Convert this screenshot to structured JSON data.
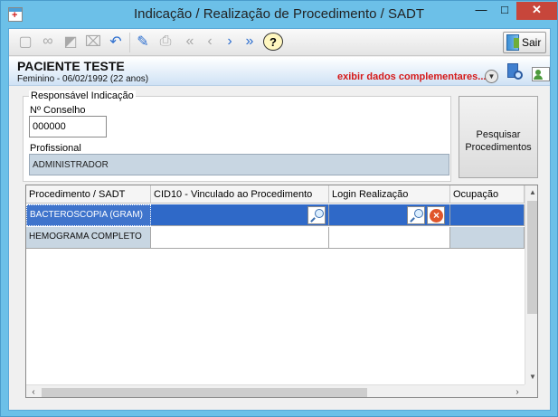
{
  "window": {
    "title": "Indicação / Realização de Procedimento / SADT",
    "min_glyph": "—",
    "max_glyph": "□",
    "close_glyph": "✕"
  },
  "toolbar": {
    "icons": [
      "new-icon",
      "binoculars-icon",
      "eraser-icon",
      "trash-icon",
      "undo-icon",
      "edit-icon",
      "print-icon",
      "first-icon",
      "prev-icon",
      "next-icon",
      "last-icon",
      "help-icon"
    ],
    "help_glyph": "?",
    "exit_label": "Sair"
  },
  "patient": {
    "name": "PACIENTE TESTE",
    "info": "Feminino - 06/02/1992 (22 anos)",
    "complement_link": "exibir dados complementares...",
    "expand_glyph": "▼"
  },
  "responsible": {
    "legend": "Responsável Indicação",
    "council_label": "Nº Conselho",
    "council_value": "000000",
    "professional_label": "Profissional",
    "professional_value": "ADMINISTRADOR"
  },
  "search_button": {
    "label": "Pesquisar Procedimentos"
  },
  "grid": {
    "columns": [
      "Procedimento / SADT",
      "CID10 - Vinculado ao Procedimento",
      "Login Realização",
      "Ocupação"
    ],
    "rows": [
      {
        "procedure": "BACTEROSCOPIA (GRAM)",
        "cid10": "",
        "login": "",
        "occupation": ""
      },
      {
        "procedure": "HEMOGRAMA COMPLETO",
        "cid10": "",
        "login": "",
        "occupation": ""
      }
    ]
  },
  "colors": {
    "title_bar": "#6cc0e8",
    "selected_row": "#2f69c8",
    "link_red": "#d61a1a",
    "readonly_field": "#c8d6e2"
  }
}
